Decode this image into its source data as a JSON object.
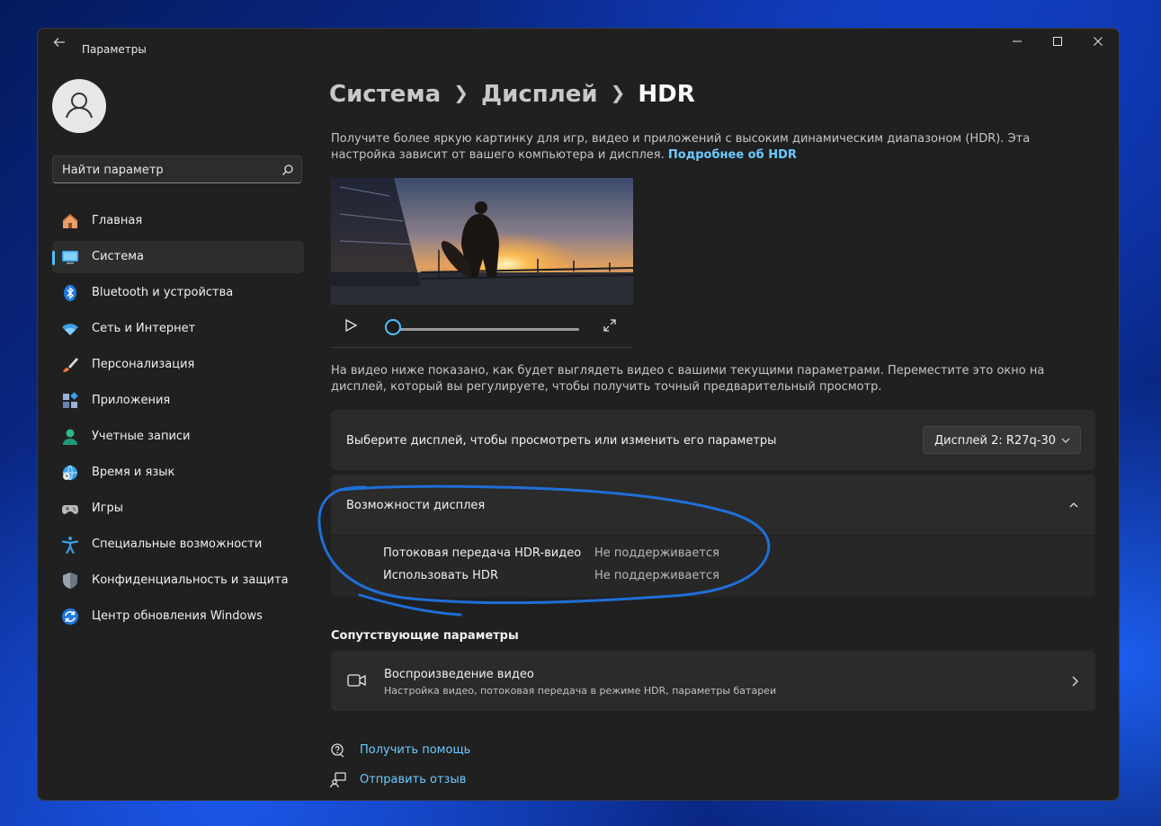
{
  "window": {
    "title": "Параметры",
    "controls": {
      "minimize": "—",
      "maximize": "☐",
      "close": "✕"
    }
  },
  "sidebar": {
    "search": {
      "placeholder": "Найти параметр"
    },
    "items": [
      {
        "label": "Главная",
        "icon": "home-icon",
        "active": false
      },
      {
        "label": "Система",
        "icon": "monitor-icon",
        "active": true
      },
      {
        "label": "Bluetooth и устройства",
        "icon": "bluetooth-icon",
        "active": false
      },
      {
        "label": "Сеть и Интернет",
        "icon": "wifi-icon",
        "active": false
      },
      {
        "label": "Персонализация",
        "icon": "brush-icon",
        "active": false
      },
      {
        "label": "Приложения",
        "icon": "apps-icon",
        "active": false
      },
      {
        "label": "Учетные записи",
        "icon": "person-icon",
        "active": false
      },
      {
        "label": "Время и язык",
        "icon": "clock-globe-icon",
        "active": false
      },
      {
        "label": "Игры",
        "icon": "gamepad-icon",
        "active": false
      },
      {
        "label": "Специальные возможности",
        "icon": "accessibility-icon",
        "active": false
      },
      {
        "label": "Конфиденциальность и защита",
        "icon": "shield-icon",
        "active": false
      },
      {
        "label": "Центр обновления Windows",
        "icon": "update-icon",
        "active": false
      }
    ]
  },
  "header": {
    "breadcrumb": [
      "Система",
      "Дисплей",
      "HDR"
    ]
  },
  "main": {
    "intro_text": "Получите более яркую картинку для игр, видео и приложений с высоким динамическим диапазоном (HDR). Эта настройка зависит от вашего компьютера и дисплея.",
    "intro_link": "Подробнее об HDR",
    "preview_text": "На видео ниже показано, как будет выглядеть видео с вашими текущими параметрами. Переместите это окно на дисплей, который вы регулируете, чтобы получить точный предварительный просмотр.",
    "video": {
      "progress": 0
    },
    "display_select": {
      "label": "Выберите дисплей, чтобы просмотреть или изменить его параметры",
      "value": "Дисплей 2: R27q-30"
    },
    "capabilities": {
      "title": "Возможности дисплея",
      "rows": [
        {
          "label": "Потоковая передача HDR-видео",
          "value": "Не поддерживается"
        },
        {
          "label": "Использовать HDR",
          "value": "Не поддерживается"
        }
      ]
    },
    "related": {
      "section_title": "Сопутствующие параметры",
      "items": [
        {
          "title": "Воспроизведение видео",
          "subtitle": "Настройка видео, потоковая передача в режиме HDR, параметры батареи"
        }
      ]
    },
    "footer_links": [
      {
        "label": "Получить помощь",
        "icon": "help-icon"
      },
      {
        "label": "Отправить отзыв",
        "icon": "feedback-icon"
      }
    ]
  },
  "colors": {
    "accent": "#4cc2ff",
    "link": "#6ccbff",
    "annotation": "#1f6fd8"
  }
}
